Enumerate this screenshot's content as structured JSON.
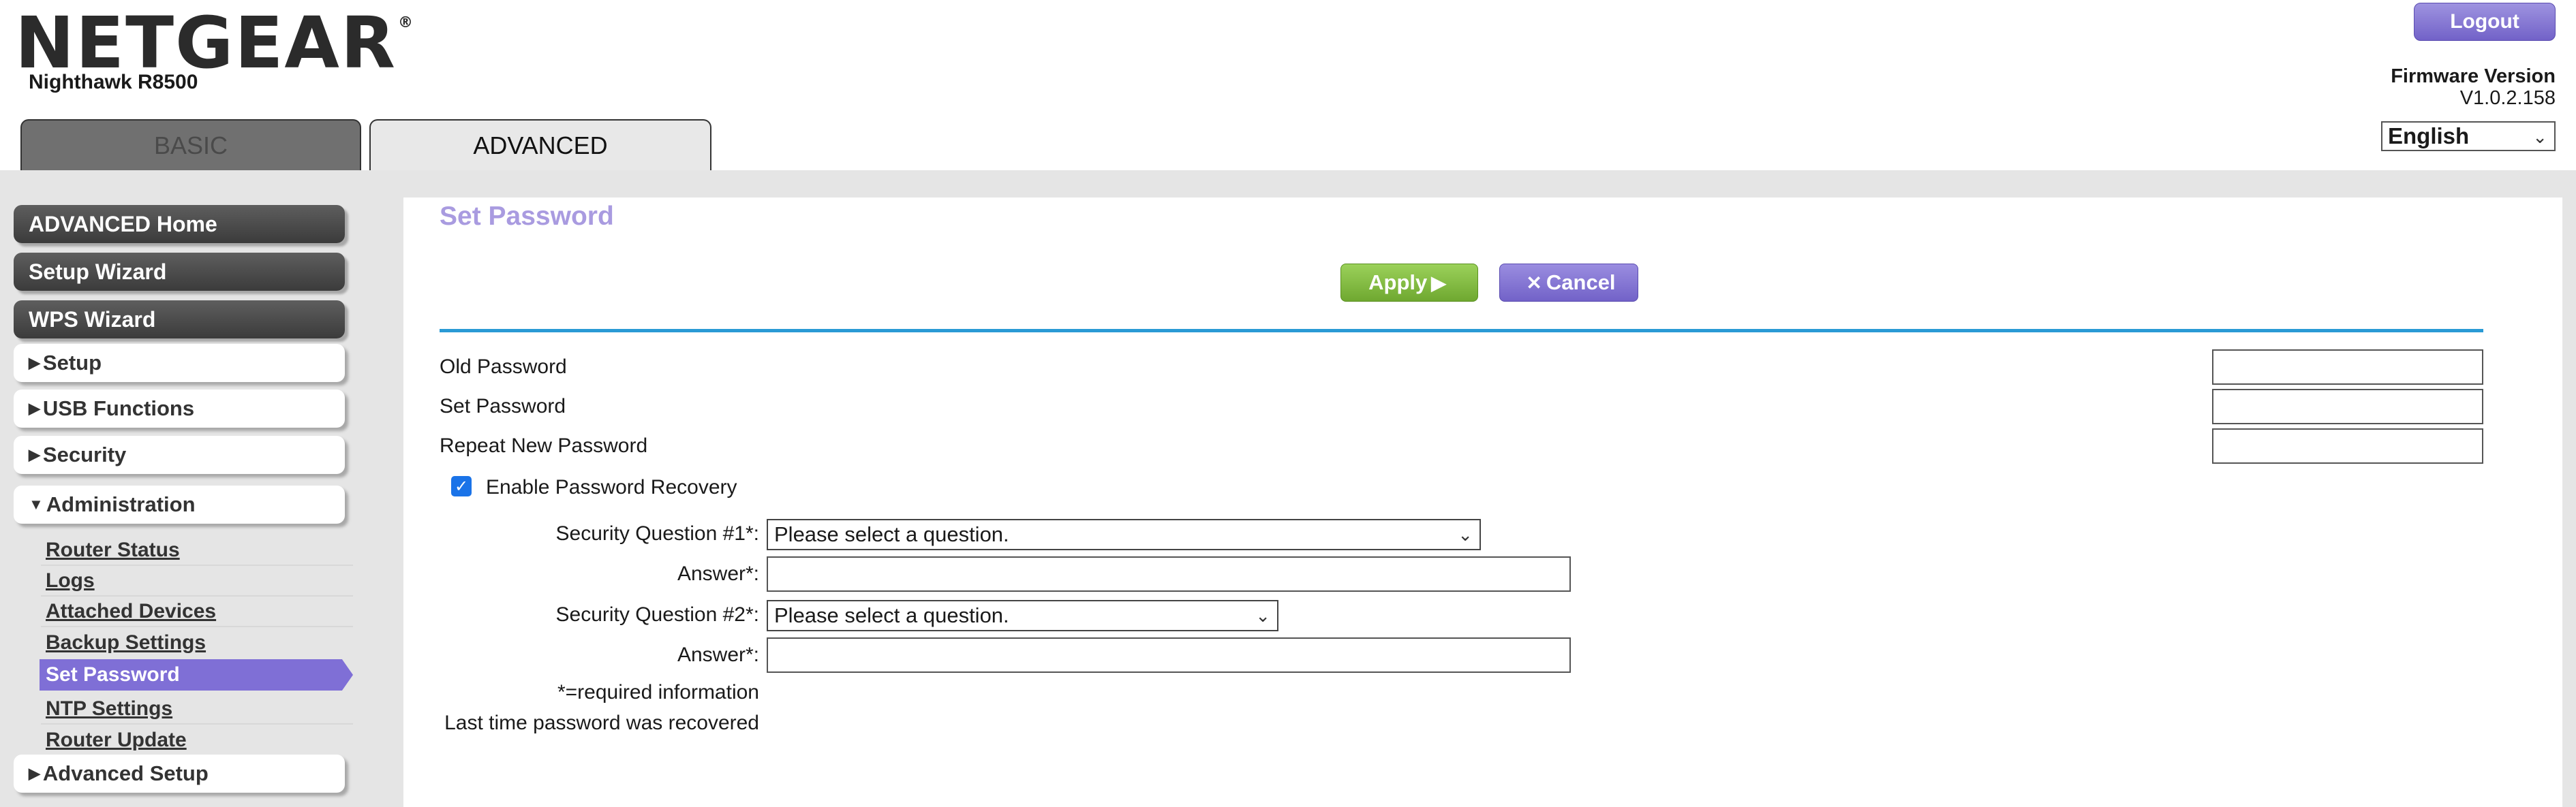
{
  "header": {
    "logo_text": "NETGEAR",
    "logo_reg": "®",
    "model": "Nighthawk R8500",
    "tabs": [
      {
        "label": "BASIC",
        "active": false
      },
      {
        "label": "ADVANCED",
        "active": true
      }
    ],
    "logout_label": "Logout",
    "firmware_label": "Firmware Version",
    "firmware_value": "V1.0.2.158",
    "language": "English"
  },
  "sidebar": {
    "primary": [
      {
        "label": "ADVANCED Home"
      },
      {
        "label": "Setup Wizard"
      },
      {
        "label": "WPS Wizard"
      }
    ],
    "sections": [
      {
        "label": "Setup",
        "expanded": false
      },
      {
        "label": "USB Functions",
        "expanded": false
      },
      {
        "label": "Security",
        "expanded": false
      },
      {
        "label": "Administration",
        "expanded": true
      },
      {
        "label": "Advanced Setup",
        "expanded": false
      }
    ],
    "admin_items": [
      {
        "label": "Router Status"
      },
      {
        "label": "Logs"
      },
      {
        "label": "Attached Devices"
      },
      {
        "label": "Backup Settings"
      },
      {
        "label": "Set Password",
        "active": true
      },
      {
        "label": "NTP Settings"
      },
      {
        "label": "Router Update"
      }
    ],
    "arrow_collapsed": "▶",
    "arrow_expanded": "▼"
  },
  "main": {
    "title": "Set Password",
    "apply_label": "Apply",
    "cancel_label": "Cancel",
    "fields": {
      "old_password_label": "Old Password",
      "set_password_label": "Set Password",
      "repeat_password_label": "Repeat New Password",
      "old_password_value": "",
      "set_password_value": "",
      "repeat_password_value": ""
    },
    "recovery": {
      "checkbox_label": "Enable Password Recovery",
      "checked": true,
      "q1_label": "Security Question #1*:",
      "q1_value": "Please select a question.",
      "answer1_label": "Answer*:",
      "answer1_value": "",
      "q2_label": "Security Question #2*:",
      "q2_value": "Please select a question.",
      "answer2_label": "Answer*:",
      "answer2_value": "",
      "required_note": "*=required information",
      "last_recovered_label": "Last time password was recovered"
    }
  },
  "colors": {
    "accent_purple": "#7f6fd6",
    "apply_green": "#7cb342",
    "rule_blue": "#2a9ad5",
    "title_lavender": "#a99be0",
    "checkbox_blue": "#1a73e8"
  },
  "icons": {
    "apply": "play-arrow-icon",
    "cancel": "close-x-icon",
    "dropdown": "chevron-down-icon",
    "check": "checkmark-icon"
  }
}
